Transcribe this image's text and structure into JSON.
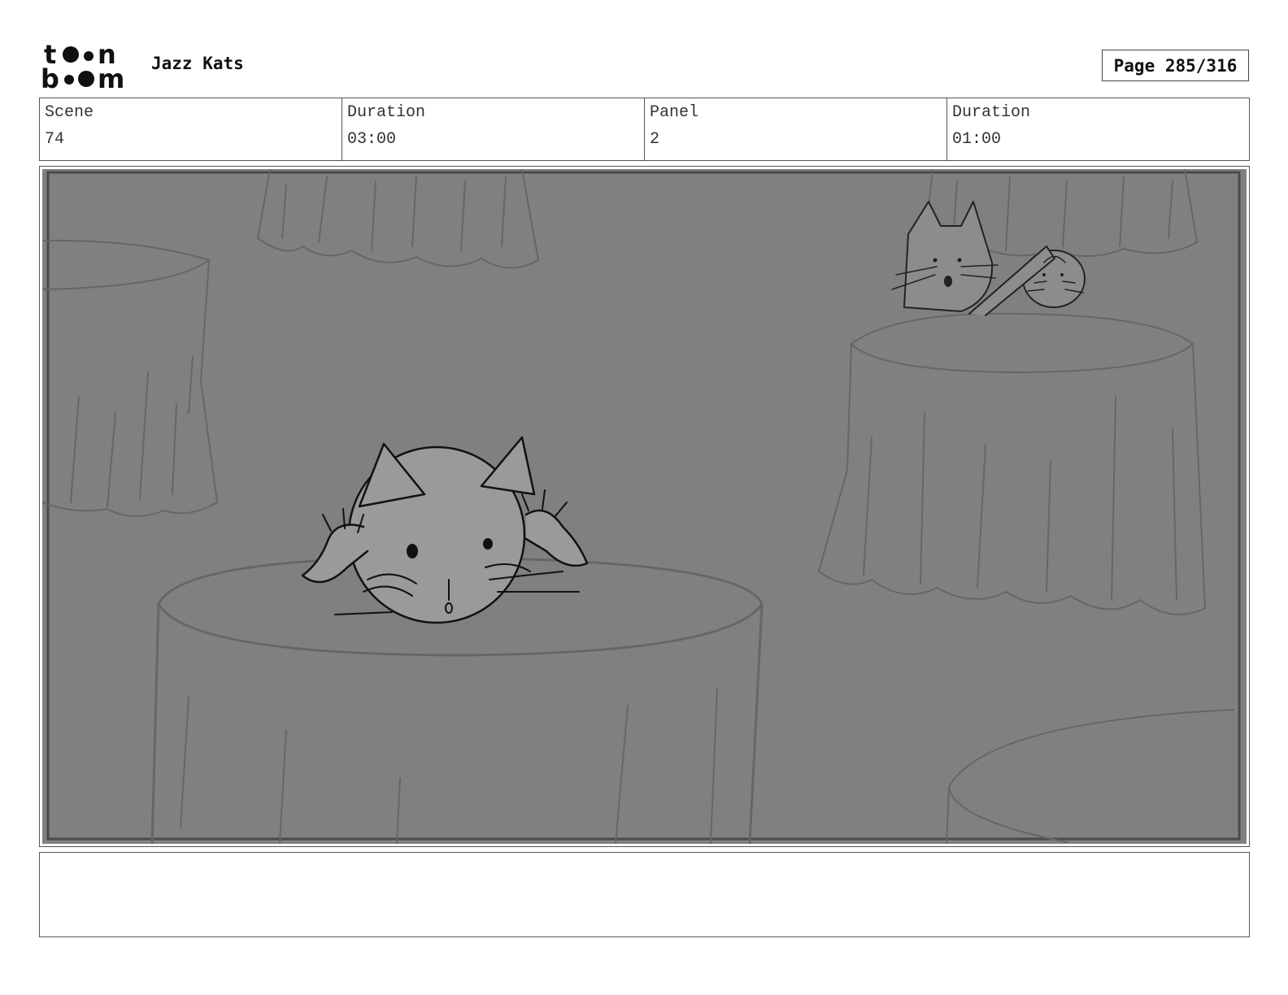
{
  "header": {
    "logo_text": "toon boom",
    "project_title": "Jazz Kats",
    "page_label": "Page 285/316"
  },
  "info": {
    "scene_label": "Scene",
    "scene_value": "74",
    "scene_duration_label": "Duration",
    "scene_duration_value": "03:00",
    "panel_label": "Panel",
    "panel_value": "2",
    "panel_duration_label": "Duration",
    "panel_duration_value": "01:00"
  },
  "notes": {
    "text": ""
  }
}
